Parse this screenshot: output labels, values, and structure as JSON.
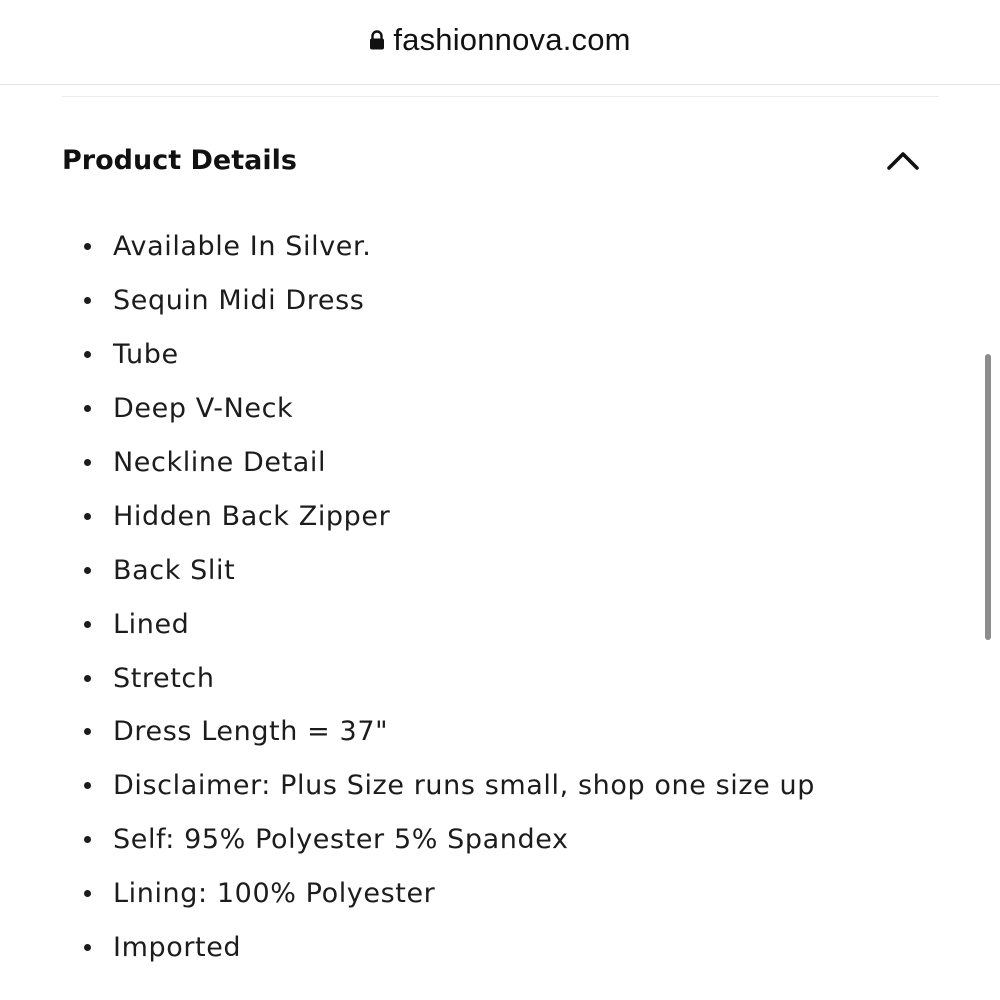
{
  "browser": {
    "url": "fashionnova.com",
    "lock_icon": "lock-icon"
  },
  "section": {
    "title": "Product Details",
    "toggle_icon": "chevron-up-icon",
    "expanded": true
  },
  "details": [
    "Available In Silver.",
    "Sequin Midi Dress",
    "Tube",
    "Deep V-Neck",
    "Neckline Detail",
    "Hidden Back Zipper",
    "Back Slit",
    "Lined",
    "Stretch",
    "Dress Length = 37\"",
    "Disclaimer: Plus Size runs small, shop one size up",
    "Self: 95% Polyester 5% Spandex",
    "Lining: 100% Polyester",
    "Imported"
  ],
  "colors": {
    "text": "#1c1c1c",
    "scrollbar": "#8c8c8c",
    "divider": "#ececec"
  }
}
